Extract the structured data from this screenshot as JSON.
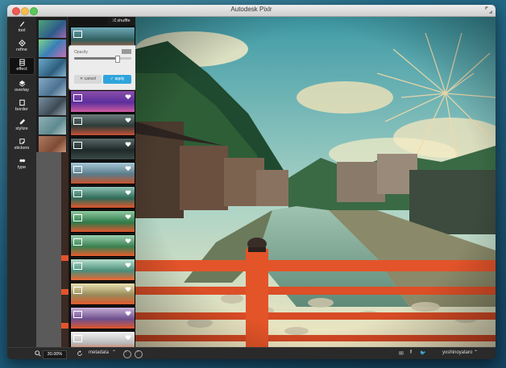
{
  "window": {
    "title": "Autodesk Pixlr"
  },
  "toolbar": {
    "items": [
      {
        "label": "tool",
        "icon": "brush-icon"
      },
      {
        "label": "refine",
        "icon": "refine-icon"
      },
      {
        "label": "effect",
        "icon": "film-icon",
        "active": true
      },
      {
        "label": "overlay",
        "icon": "overlay-icon"
      },
      {
        "label": "border",
        "icon": "border-icon"
      },
      {
        "label": "stylize",
        "icon": "pen-icon"
      },
      {
        "label": "stickers",
        "icon": "sticker-icon"
      },
      {
        "label": "type",
        "icon": "type-icon"
      }
    ]
  },
  "effects": {
    "shuffle_label": "shuffle",
    "opacity_label": "Opacity",
    "opacity_percent": 75,
    "cancel_label": "cancel",
    "apply_label": "apply",
    "items_count_visible": 12
  },
  "statusbar": {
    "zoom": "30.00%",
    "metadata_label": "metadata",
    "username": "yoshinoyataro"
  },
  "colors": {
    "accent_blue": "#2fa4dc",
    "bridge_red": "#e4542a",
    "dark_panel": "#2a2a2a"
  }
}
